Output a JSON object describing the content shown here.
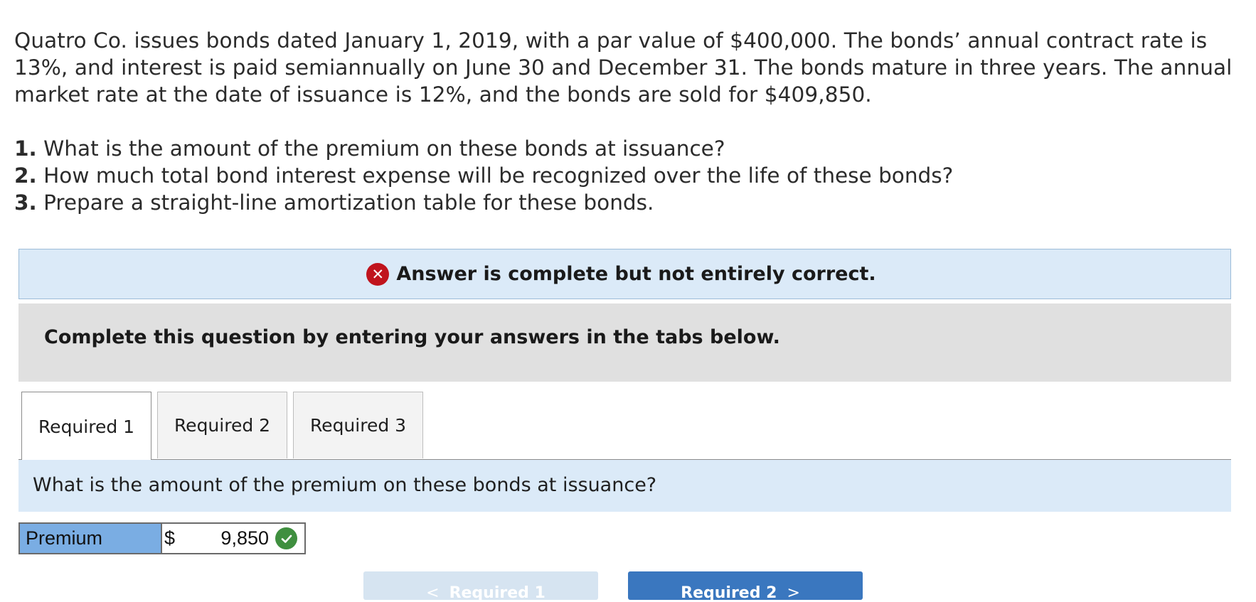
{
  "problem": {
    "text": "Quatro Co. issues bonds dated January 1, 2019, with a par value of $400,000. The bonds’ annual contract rate is 13%, and interest is paid semiannually on June 30 and December 31. The bonds mature in three years. The annual market rate at the date of issuance is 12%, and the bonds are sold for $409,850."
  },
  "questions": [
    {
      "number": "1.",
      "text": "What is the amount of the premium on these bonds at issuance?"
    },
    {
      "number": "2.",
      "text": "How much total bond interest expense will be recognized over the life of these bonds?"
    },
    {
      "number": "3.",
      "text": "Prepare a straight-line amortization table for these bonds."
    }
  ],
  "feedback": {
    "icon": "x-circle-icon",
    "message": "Answer is complete but not entirely correct.",
    "icon_color": "#c0141d"
  },
  "instructions": "Complete this question by entering your answers in the tabs below.",
  "tabs": [
    {
      "label": "Required 1",
      "active": true
    },
    {
      "label": "Required 2",
      "active": false
    },
    {
      "label": "Required 3",
      "active": false
    }
  ],
  "prompt": "What is the amount of the premium on these bonds at issuance?",
  "answer": {
    "label": "Premium",
    "currency": "$",
    "value": "9,850",
    "status_icon": "check-circle-icon",
    "status": "correct"
  },
  "navigation": {
    "prev_label": "Required 1",
    "next_label": "Required 2"
  },
  "colors": {
    "accent_blue": "#3a77bf",
    "panel_blue": "#dbeaf8",
    "label_blue": "#7aade3",
    "correct_green": "#3f8f3f"
  }
}
